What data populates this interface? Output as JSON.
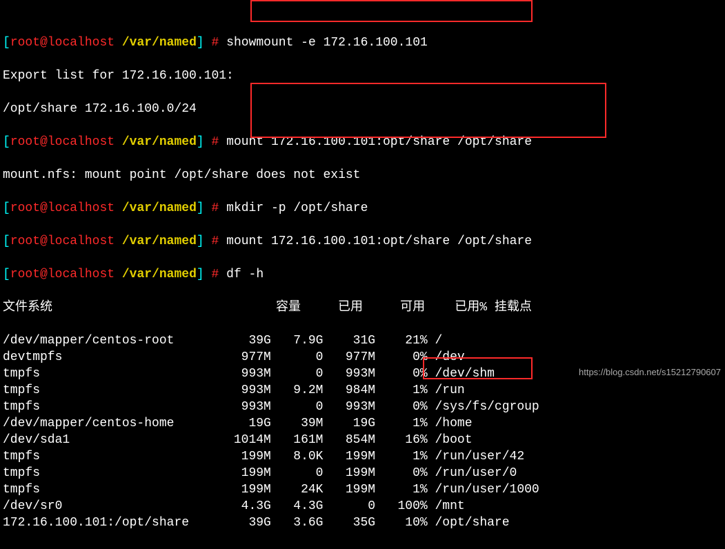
{
  "prompt": {
    "user": "root",
    "host": "localhost",
    "cwd": "/var/named",
    "symbol": "#"
  },
  "commands": {
    "c1": "showmount -e 172.16.100.101",
    "c2": "mount 172.16.100.101:opt/share /opt/share",
    "c3": "mkdir -p /opt/share",
    "c4": "mount 172.16.100.101:opt/share /opt/share",
    "c5": "df -h"
  },
  "output": {
    "export_header": "Export list for 172.16.100.101:",
    "export_line": "/opt/share 172.16.100.0/24",
    "mount_err": "mount.nfs: mount point /opt/share does not exist"
  },
  "df_header": {
    "fs": "文件系统",
    "size": "容量",
    "used": "已用",
    "avail": "可用",
    "pct": "已用%",
    "mnt": "挂载点"
  },
  "df_rows": [
    {
      "fs": "/dev/mapper/centos-root",
      "size": "39G",
      "used": "7.9G",
      "avail": "31G",
      "pct": "21%",
      "mnt": "/"
    },
    {
      "fs": "devtmpfs",
      "size": "977M",
      "used": "0",
      "avail": "977M",
      "pct": "0%",
      "mnt": "/dev"
    },
    {
      "fs": "tmpfs",
      "size": "993M",
      "used": "0",
      "avail": "993M",
      "pct": "0%",
      "mnt": "/dev/shm"
    },
    {
      "fs": "tmpfs",
      "size": "993M",
      "used": "9.2M",
      "avail": "984M",
      "pct": "1%",
      "mnt": "/run"
    },
    {
      "fs": "tmpfs",
      "size": "993M",
      "used": "0",
      "avail": "993M",
      "pct": "0%",
      "mnt": "/sys/fs/cgroup"
    },
    {
      "fs": "/dev/mapper/centos-home",
      "size": "19G",
      "used": "39M",
      "avail": "19G",
      "pct": "1%",
      "mnt": "/home"
    },
    {
      "fs": "/dev/sda1",
      "size": "1014M",
      "used": "161M",
      "avail": "854M",
      "pct": "16%",
      "mnt": "/boot"
    },
    {
      "fs": "tmpfs",
      "size": "199M",
      "used": "8.0K",
      "avail": "199M",
      "pct": "1%",
      "mnt": "/run/user/42"
    },
    {
      "fs": "tmpfs",
      "size": "199M",
      "used": "0",
      "avail": "199M",
      "pct": "0%",
      "mnt": "/run/user/0"
    },
    {
      "fs": "tmpfs",
      "size": "199M",
      "used": "24K",
      "avail": "199M",
      "pct": "1%",
      "mnt": "/run/user/1000"
    },
    {
      "fs": "/dev/sr0",
      "size": "4.3G",
      "used": "4.3G",
      "avail": "0",
      "pct": "100%",
      "mnt": "/mnt"
    },
    {
      "fs": "172.16.100.101:/opt/share",
      "size": "39G",
      "used": "3.6G",
      "avail": "35G",
      "pct": "10%",
      "mnt": "/opt/share"
    }
  ],
  "watermark": "https://blog.csdn.net/s15212790607"
}
